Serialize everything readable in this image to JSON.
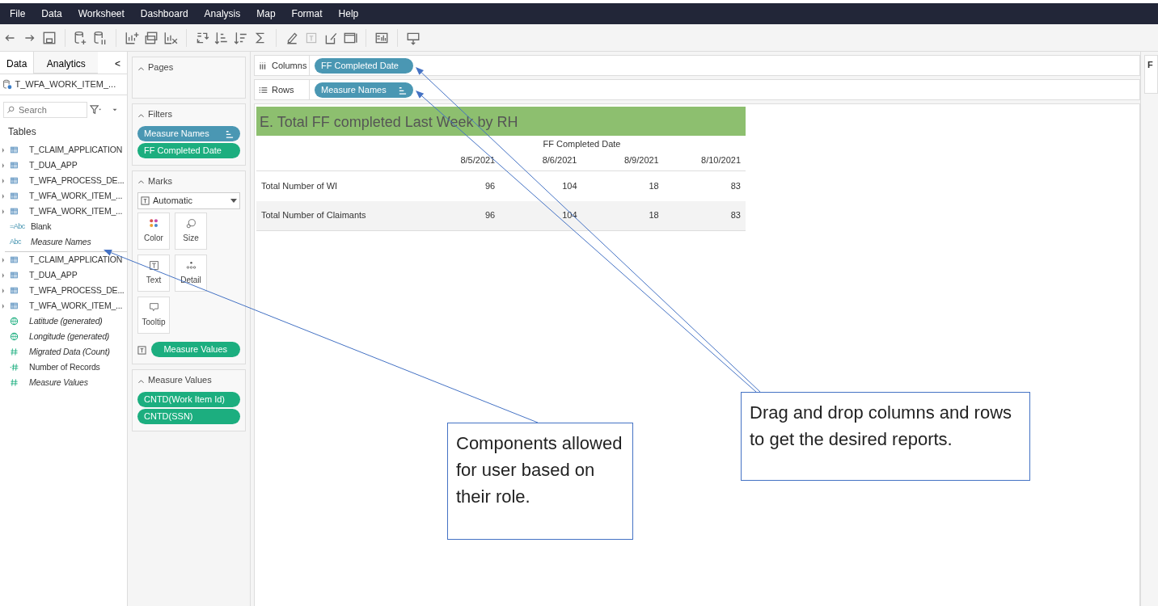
{
  "menu": [
    "File",
    "Data",
    "Worksheet",
    "Dashboard",
    "Analysis",
    "Map",
    "Format",
    "Help"
  ],
  "data_pane": {
    "tabs": [
      {
        "label": "Data",
        "selected": true
      },
      {
        "label": "Analytics",
        "selected": false
      }
    ],
    "collapse": "<",
    "datasource": "T_WFA_WORK_ITEM_...",
    "search": {
      "placeholder": "Search"
    },
    "tables_heading": "Tables",
    "field_groups": [
      [
        {
          "kind": "table",
          "label": "T_CLAIM_APPLICATION",
          "italic": false
        },
        {
          "kind": "table",
          "label": "T_DUA_APP",
          "italic": false
        },
        {
          "kind": "table",
          "label": "T_WFA_PROCESS_DE...",
          "italic": false
        },
        {
          "kind": "table",
          "label": "T_WFA_WORK_ITEM_...",
          "italic": false
        },
        {
          "kind": "table",
          "label": "T_WFA_WORK_ITEM_...",
          "italic": false
        },
        {
          "kind": "calc-text",
          "type_label": "=Abc",
          "label": "Blank",
          "italic": false
        },
        {
          "kind": "text",
          "type_label": "Abc",
          "label": "Measure Names",
          "italic": true
        }
      ],
      [
        {
          "kind": "table",
          "label": "T_CLAIM_APPLICATION",
          "italic": false
        },
        {
          "kind": "table",
          "label": "T_DUA_APP",
          "italic": false
        },
        {
          "kind": "table",
          "label": "T_WFA_PROCESS_DE...",
          "italic": false
        },
        {
          "kind": "table",
          "label": "T_WFA_WORK_ITEM_...",
          "italic": false
        },
        {
          "kind": "geo",
          "label": "Latitude (generated)",
          "italic": true
        },
        {
          "kind": "geo",
          "label": "Longitude (generated)",
          "italic": true
        },
        {
          "kind": "number",
          "label": "Migrated Data (Count)",
          "italic": true
        },
        {
          "kind": "calc-number",
          "label": "Number of Records",
          "italic": false
        },
        {
          "kind": "number",
          "label": "Measure Values",
          "italic": true
        }
      ]
    ]
  },
  "pages": {
    "title": "Pages"
  },
  "filters": {
    "title": "Filters",
    "pills": [
      {
        "label": "Measure Names",
        "color": "#4a97b3",
        "sorted": true
      },
      {
        "label": "FF Completed Date",
        "color": "#1cae7f",
        "sorted": false
      }
    ]
  },
  "marks": {
    "title": "Marks",
    "type": "Automatic",
    "buttons": [
      {
        "kind": "color",
        "label": "Color"
      },
      {
        "kind": "size",
        "label": "Size"
      },
      {
        "kind": "text",
        "label": "Text"
      },
      {
        "kind": "detail",
        "label": "Detail"
      },
      {
        "kind": "tooltip",
        "label": "Tooltip"
      }
    ],
    "pill": {
      "label": "Measure Values",
      "color": "#1cae7f"
    }
  },
  "measure_values": {
    "title": "Measure Values",
    "pills": [
      {
        "label": "CNTD(Work Item Id)",
        "color": "#1cae7f"
      },
      {
        "label": "CNTD(SSN)",
        "color": "#1cae7f"
      }
    ]
  },
  "shelves": [
    {
      "kind": "columns",
      "label": "Columns",
      "pill": {
        "label": "FF Completed Date",
        "color": "#4a97b3",
        "sorted": false
      }
    },
    {
      "kind": "rows",
      "label": "Rows",
      "pill": {
        "label": "Measure Names",
        "color": "#4a97b3",
        "sorted": true
      }
    }
  ],
  "view": {
    "title": "E. Total FF completed Last Week by RH",
    "column_header": "FF Completed Date",
    "columns": [
      "8/5/2021",
      "8/6/2021",
      "8/9/2021",
      "8/10/2021"
    ],
    "rows": [
      {
        "label": "Total Number of WI",
        "values": [
          "96",
          "104",
          "18",
          "83"
        ]
      },
      {
        "label": "Total Number of Claimants",
        "values": [
          "96",
          "104",
          "18",
          "83"
        ]
      }
    ]
  },
  "right_panel": {
    "title": "F"
  },
  "callouts": [
    {
      "text": "Components allowed for user based on their role."
    },
    {
      "text": "Drag and drop columns and rows to get the desired reports."
    }
  ]
}
